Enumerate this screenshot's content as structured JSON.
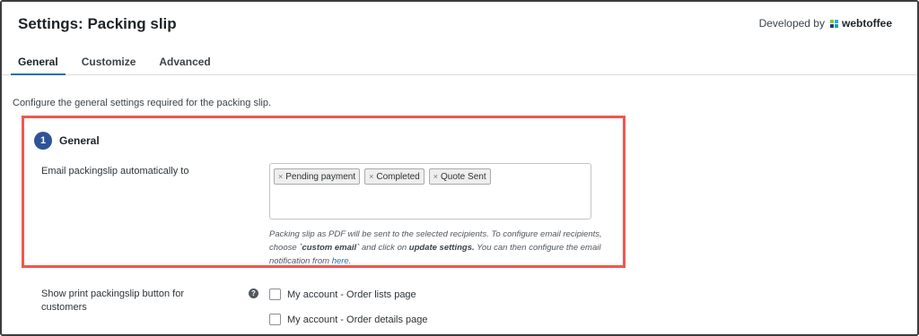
{
  "header": {
    "title": "Settings: Packing slip",
    "developed_by": "Developed by",
    "brand": "webtoffee",
    "brand_colors": [
      "#7ac943",
      "#29abe2",
      "#2e3192",
      "#00a99d"
    ]
  },
  "tabs": [
    {
      "label": "General",
      "active": true
    },
    {
      "label": "Customize",
      "active": false
    },
    {
      "label": "Advanced",
      "active": false
    }
  ],
  "intro": "Configure the general settings required for the packing slip.",
  "section": {
    "number": "1",
    "title": "General",
    "email_label": "Email packingslip automatically to",
    "selected_statuses": [
      "Pending payment",
      "Completed",
      "Quote Sent"
    ],
    "help": {
      "part1": "Packing slip as PDF will be sent to the selected recipients. To configure email recipients, choose ",
      "bold1": "`custom email`",
      "part2": " and click on ",
      "bold2": "update settings.",
      "part3": " You can then configure the email notification from ",
      "link": "here",
      "part4": "."
    }
  },
  "print_button": {
    "label": "Show print packingslip button for customers",
    "help_icon": "?",
    "options": [
      {
        "label": "My account - Order lists page",
        "checked": false
      },
      {
        "label": "My account - Order details page",
        "checked": false
      }
    ]
  },
  "colors": {
    "accent": "#2271b1",
    "step_badge": "#2f5496",
    "highlight_border": "#f0564f"
  }
}
